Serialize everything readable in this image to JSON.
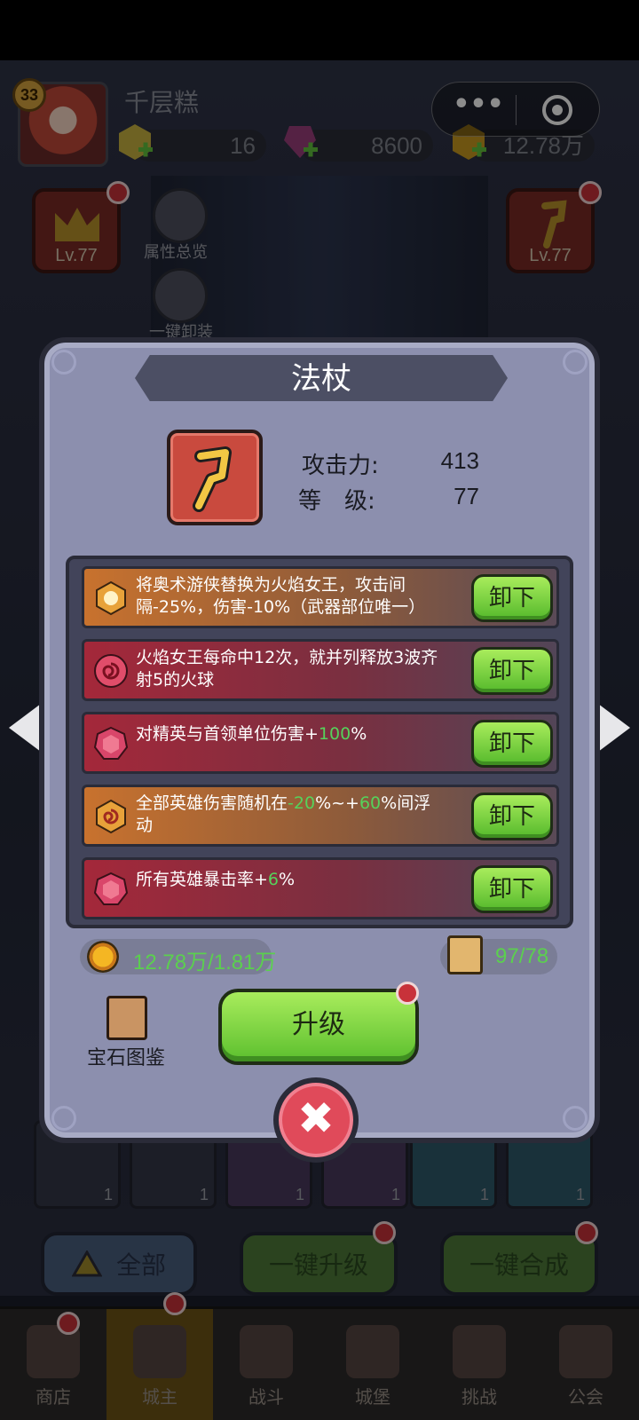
{
  "player": {
    "level": "33",
    "name": "千层糕"
  },
  "resources": [
    {
      "icon": "hexagon-gem-icon",
      "value": "16"
    },
    {
      "icon": "crystal-icon",
      "value": "8600"
    },
    {
      "icon": "gold-coin-icon",
      "value": "12.78万"
    }
  ],
  "side_buttons": {
    "crown_level": "Lv.77",
    "staff_level": "Lv.77",
    "attr_overview": "属性总览",
    "one_key_equip": "一键卸装"
  },
  "dialog": {
    "title": "法杖",
    "stats": {
      "attack_label": "攻击力:",
      "attack_value": "413",
      "level_label": "等　级:",
      "level_value": "77"
    },
    "effects": [
      {
        "gem": "orange-sun-gem-icon",
        "text": "将奥术游侠替换为火焰女王，攻击间隔-25%，伤害-10%（武器部位唯一）",
        "button": "卸下"
      },
      {
        "gem": "red-spiral-gem-icon",
        "text": "火焰女王每命中12次，就并列释放3波齐射5的火球",
        "button": "卸下"
      },
      {
        "gem": "red-gem-icon",
        "text_parts": [
          "对精英与首领单位伤害+",
          "100",
          "%"
        ],
        "button": "卸下"
      },
      {
        "gem": "orange-spiral-gem-icon",
        "text_parts": [
          "全部英雄伤害随机在",
          "-20",
          "%~+",
          "60",
          "%间浮动"
        ],
        "button": "卸下"
      },
      {
        "gem": "red-gem-icon",
        "text_parts": [
          "所有英雄暴击率+",
          "6",
          "%"
        ],
        "button": "卸下"
      }
    ],
    "gold_cost": "12.78万/1.81万",
    "fragment_cost": "97/78",
    "gem_atlas": "宝石图鉴",
    "upgrade": "升级",
    "close": "✖"
  },
  "actions": {
    "all": "全部",
    "upgrade_all": "一键升级",
    "merge_all": "一键合成"
  },
  "inventory_counts": [
    "1",
    "1",
    "1",
    "1",
    "1",
    "1"
  ],
  "nav": [
    "商店",
    "城主",
    "战斗",
    "城堡",
    "挑战",
    "公会"
  ],
  "capsule": {
    "more": "•••"
  },
  "colors": {
    "accent_green": "#56d25b",
    "dialog_bg": "#8c8fae",
    "button_green": "#7fd444"
  }
}
